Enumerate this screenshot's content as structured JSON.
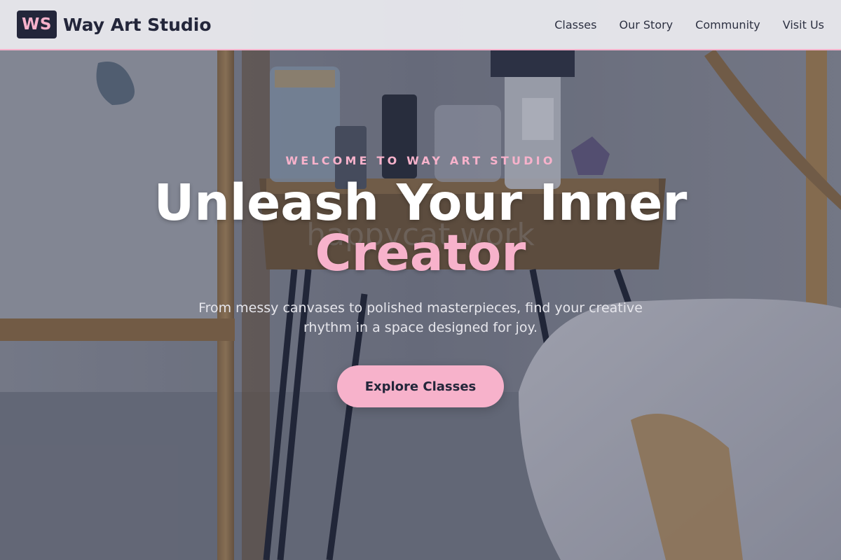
{
  "nav": {
    "logo_mark": "WS",
    "brand_name": "Way Art Studio",
    "links": [
      "Classes",
      "Our Story",
      "Community",
      "Visit Us"
    ]
  },
  "hero": {
    "eyebrow": "WELCOME TO WAY ART STUDIO",
    "headline_line1": "Unleash Your Inner",
    "headline_line2": "Creator",
    "subtitle": "From messy canvases to polished masterpieces, find your creative rhythm in a space designed for joy.",
    "cta_label": "Explore Classes",
    "background_image": "art-studio-table-photo",
    "watermark": "happycat.work"
  },
  "colors": {
    "accent_pink": "#f7b2cb",
    "dark_navy": "#23263a",
    "nav_bg": "#ececf0",
    "white": "#ffffff"
  }
}
